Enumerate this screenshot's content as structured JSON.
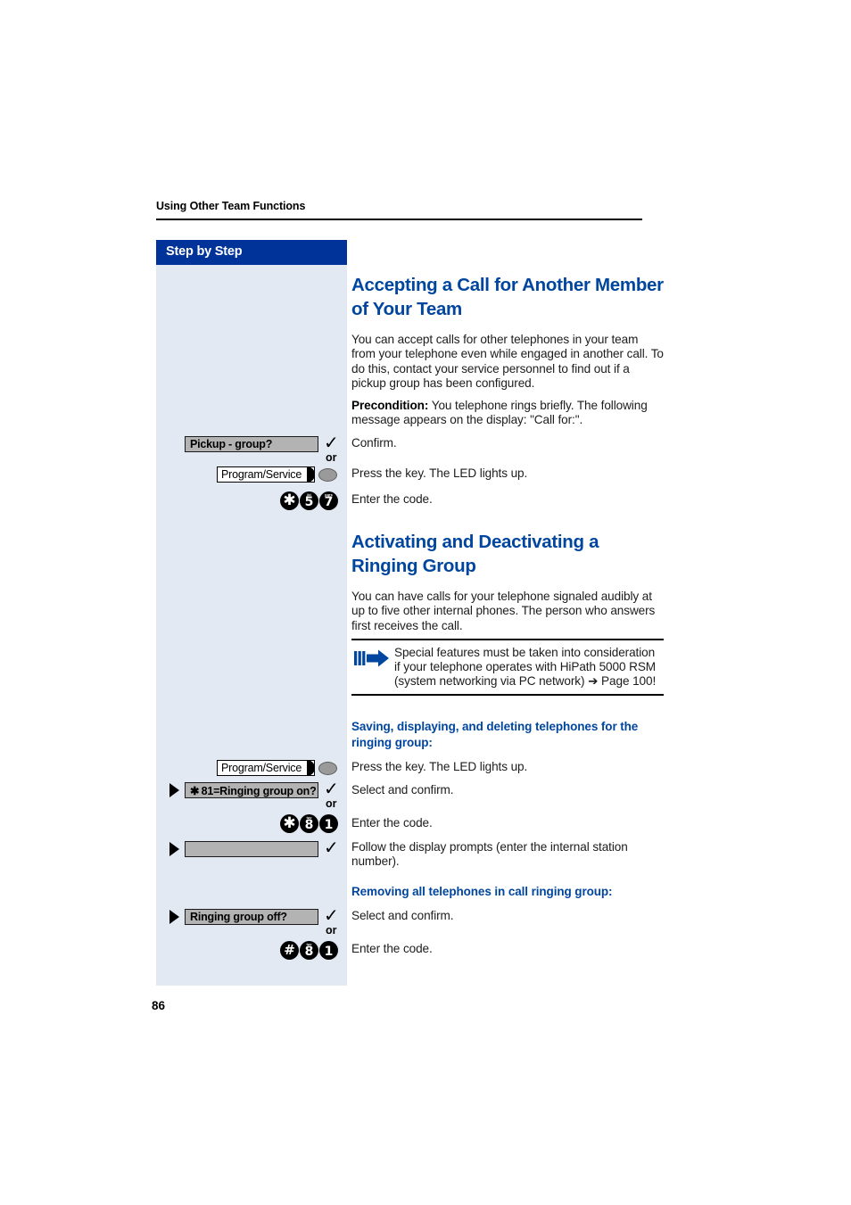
{
  "document": {
    "running_header": "Using Other Team Functions",
    "page_number": "86"
  },
  "sidebar": {
    "title": "Step by Step",
    "background_color": "#e3e9f3",
    "title_bar_color": "#00339a"
  },
  "sections": [
    {
      "heading": "Accepting a Call for Another Member of Your Team",
      "paragraphs": [
        "You can accept calls for other telephones in your team from your telephone even while engaged in another call. To do this, contact your service personnel to find out if a pickup group has been configured."
      ],
      "precondition_label": "Precondition:",
      "precondition_text": " You telephone rings briefly. The following message appears on the display: \"Call for:\"."
    },
    {
      "heading": "Activating and Deactivating a Ringing Group",
      "paragraphs": [
        "You can have calls for your telephone signaled audibly at up to five other internal phones. The person who answers first receives the call."
      ]
    }
  ],
  "note": {
    "icon": "blue-arrow-icon",
    "text": "Special features must be taken into consideration if your telephone operates with HiPath 5000 RSM (system networking via PC network) ➔ Page 100!"
  },
  "subheadings": {
    "saving": "Saving, displaying, and deleting telephones for the ringing group:",
    "removing": "Removing all telephones in call ringing group:"
  },
  "instructions": {
    "confirm": "Confirm.",
    "press_key_led": "Press the key. The LED lights up.",
    "enter_code": "Enter the code.",
    "select_confirm": "Select and confirm.",
    "follow_prompts": "Follow the display prompts (enter the internal station number).",
    "press_key_led_2": "Press the key. The LED lights up.",
    "select_confirm_2": "Select and confirm.",
    "enter_code_2": "Enter the code.",
    "enter_code_3": "Enter the code."
  },
  "steps": {
    "or_label": "or",
    "pickup_group": {
      "display_label": "Pickup - group?",
      "checkmark": "✓"
    },
    "program_service_1": {
      "key_label": "Program/Service"
    },
    "code_57": {
      "keys": [
        {
          "digit": "✱",
          "sup": "",
          "type": "star"
        },
        {
          "digit": "5",
          "sup": "jkl",
          "type": "digit"
        },
        {
          "digit": "7",
          "sup": "pqrs",
          "type": "digit"
        }
      ]
    },
    "program_service_2": {
      "key_label": "Program/Service"
    },
    "ringing_group_on": {
      "display_label": "✱ 81=Ringing group on?",
      "checkmark": "✓"
    },
    "code_81": {
      "keys": [
        {
          "digit": "✱",
          "sup": "",
          "type": "star"
        },
        {
          "digit": "8",
          "sup": "tuv",
          "type": "digit"
        },
        {
          "digit": "1",
          "sup": "",
          "type": "digit"
        }
      ]
    },
    "blank_field": {
      "display_label": "",
      "checkmark": "✓"
    },
    "ringing_group_off": {
      "display_label": "Ringing group off?",
      "checkmark": "✓"
    },
    "code_hash_81": {
      "keys": [
        {
          "digit": "#",
          "sup": "",
          "type": "hash"
        },
        {
          "digit": "8",
          "sup": "tuv",
          "type": "digit"
        },
        {
          "digit": "1",
          "sup": "",
          "type": "digit"
        }
      ]
    }
  }
}
